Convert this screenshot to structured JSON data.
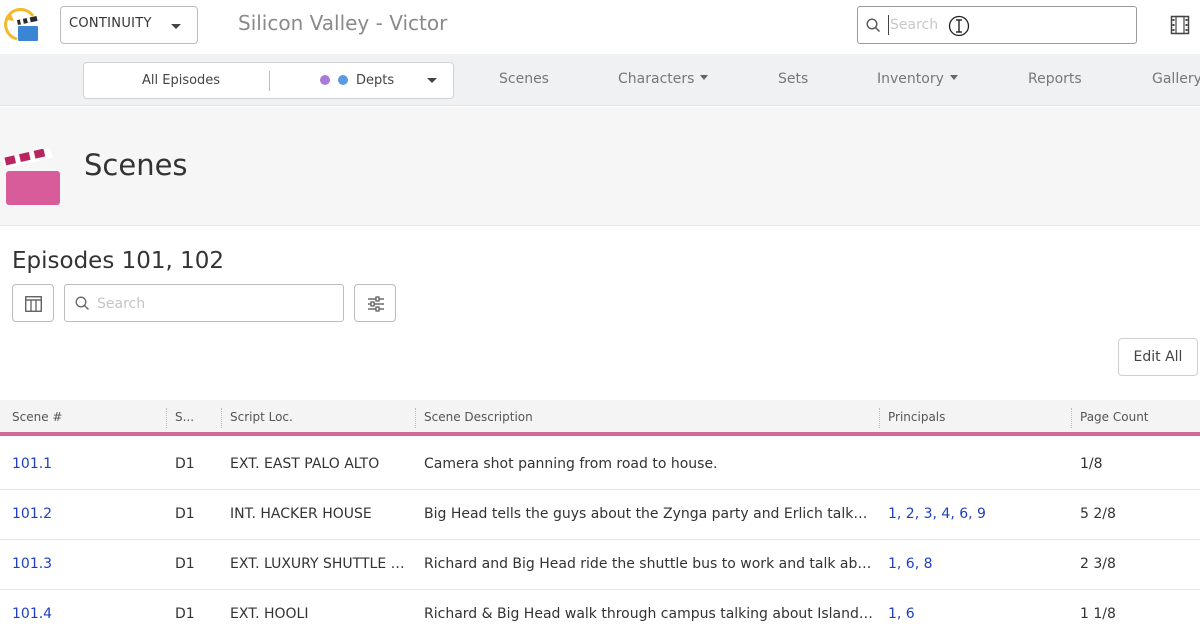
{
  "topbar": {
    "workspace_label": "CONTINUITY",
    "project_title": "Silicon Valley - Victor",
    "search_placeholder": "Search"
  },
  "navbar": {
    "episodes_filter": "All Episodes",
    "depts_filter": "Depts",
    "items": [
      {
        "label": "Scenes"
      },
      {
        "label": "Characters"
      },
      {
        "label": "Sets"
      },
      {
        "label": "Inventory"
      },
      {
        "label": "Reports"
      },
      {
        "label": "Gallery"
      }
    ]
  },
  "header": {
    "title": "Scenes"
  },
  "content": {
    "episodes_title": "Episodes 101, 102",
    "search_placeholder": "Search",
    "edit_all_label": "Edit All"
  },
  "table": {
    "columns": [
      "Scene #",
      "S...",
      "Script Loc.",
      "Scene Description",
      "Principals",
      "Page Count"
    ],
    "rows": [
      {
        "scene": "101.1",
        "s": "D1",
        "loc": "EXT. EAST PALO ALTO",
        "desc": "Camera shot panning from road to house.",
        "principals": "",
        "pages": "1/8"
      },
      {
        "scene": "101.2",
        "s": "D1",
        "loc": "INT. HACKER HOUSE",
        "desc": "Big Head tells the guys about the Zynga party and Erlich talks to Ri...",
        "principals": "1, 2, 3, 4, 6, 9",
        "pages": "5 2/8"
      },
      {
        "scene": "101.3",
        "s": "D1",
        "loc": "EXT. LUXURY SHUTTLE VAN",
        "desc": "Richard and Big Head ride the shuttle bus to work and talk about r...",
        "principals": "1, 6, 8",
        "pages": "2 3/8"
      },
      {
        "scene": "101.4",
        "s": "D1",
        "loc": "EXT. HOOLI",
        "desc": "Richard & Big Head walk through campus talking about Island Pet...",
        "principals": "1, 6",
        "pages": "1 1/8"
      }
    ]
  },
  "colors": {
    "accent_pink": "#d06a96",
    "link_blue": "#1f3fbf",
    "dept_purple": "#a97bd9",
    "dept_blue": "#5b9be3"
  }
}
